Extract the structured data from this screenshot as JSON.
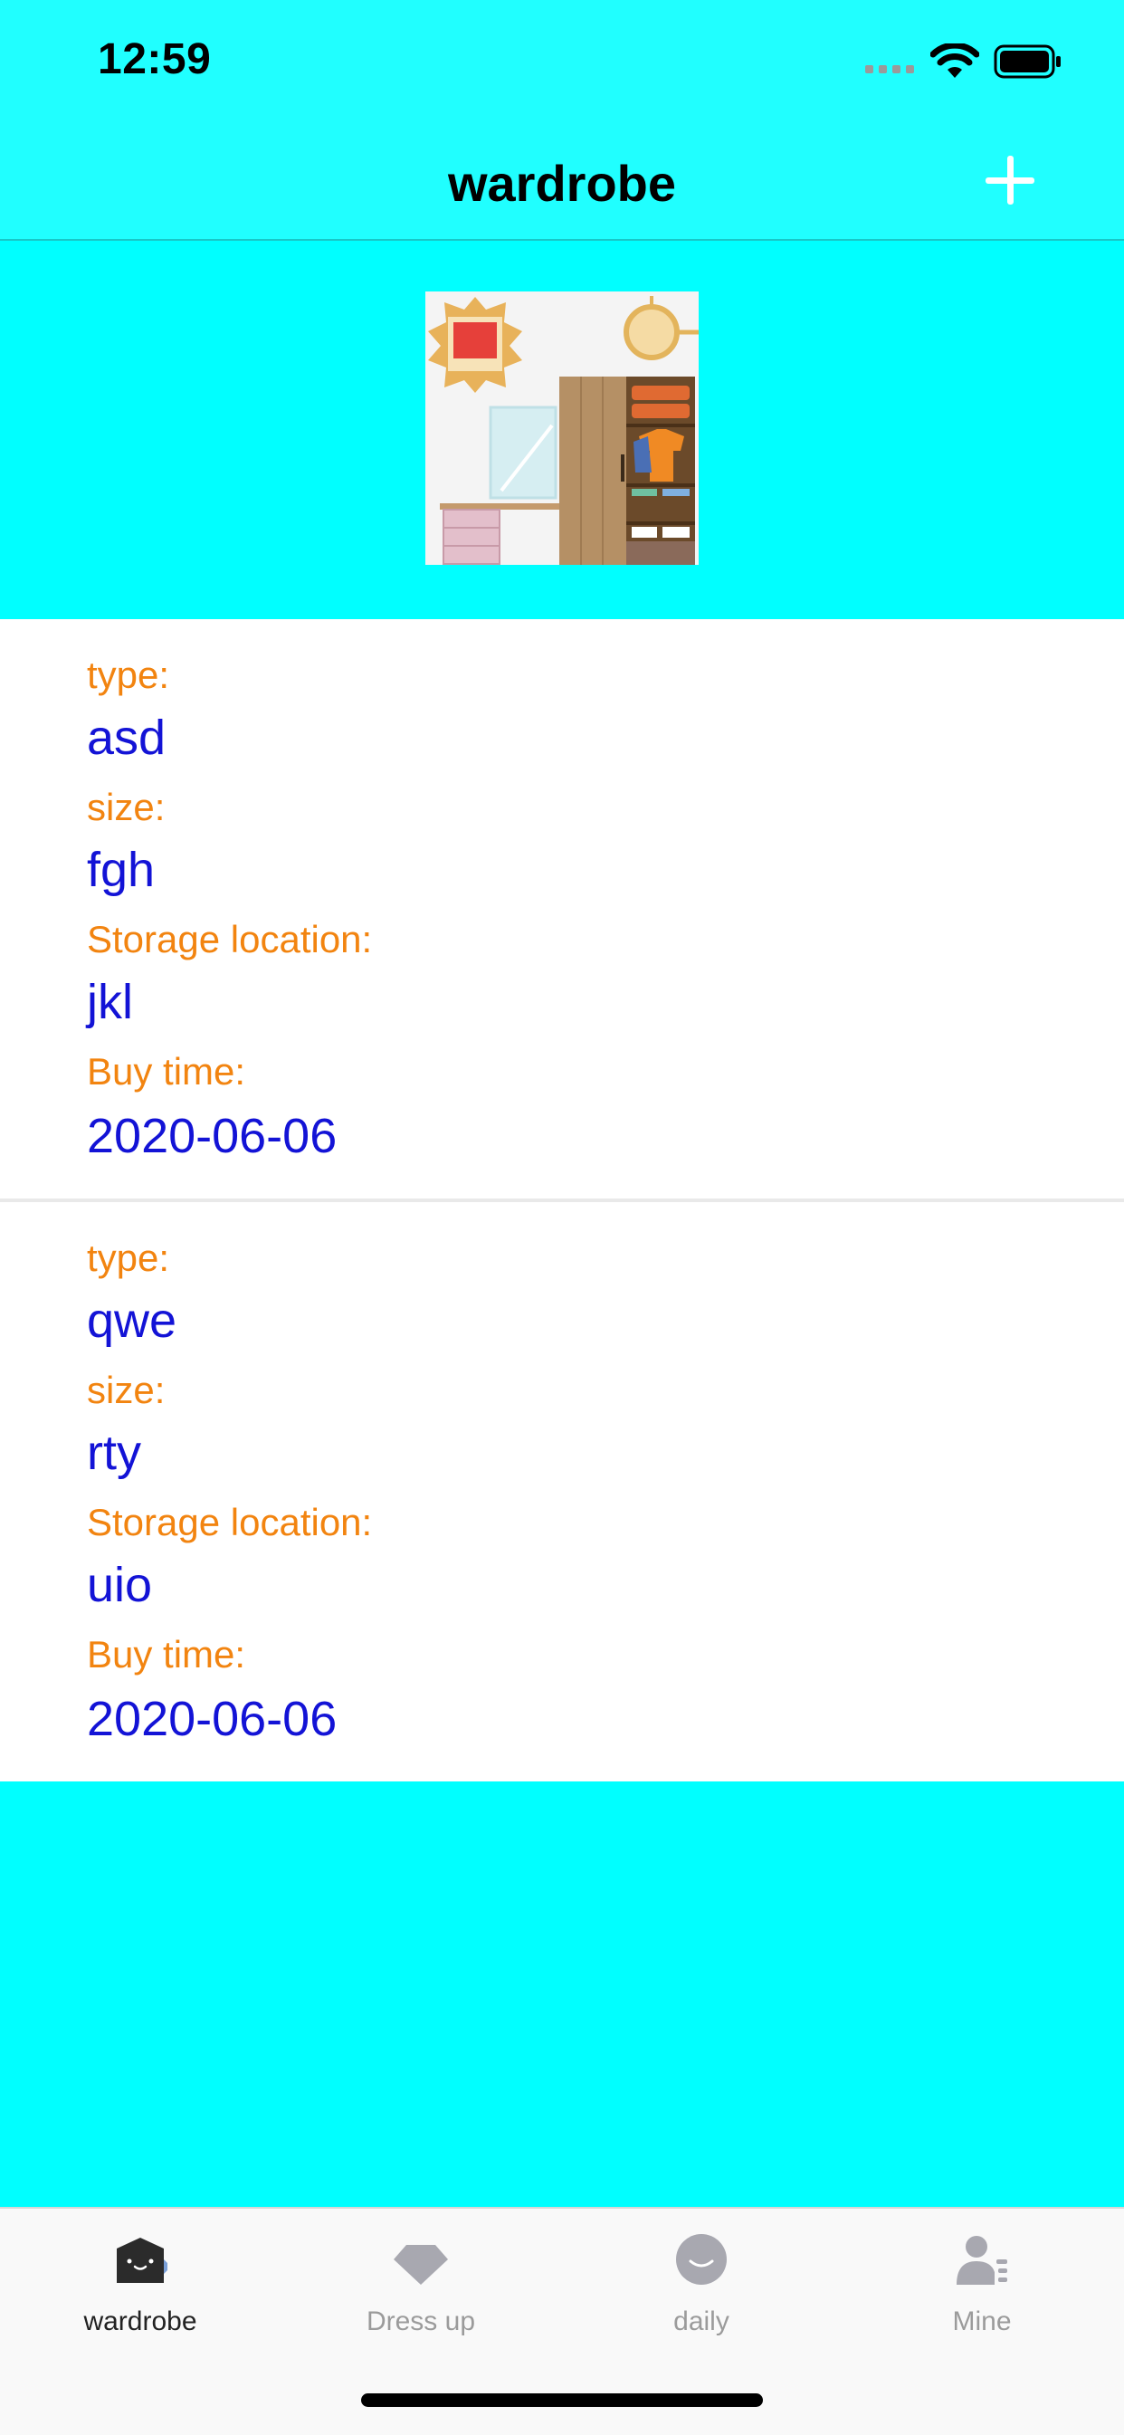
{
  "status_bar": {
    "time": "12:59"
  },
  "nav": {
    "title": "wardrobe",
    "add_icon": "plus-icon"
  },
  "colors": {
    "background": "#00FFFF",
    "label": "#F28410",
    "value": "#1313D6"
  },
  "items": [
    {
      "type_label": "type:",
      "type": "asd",
      "size_label": "size:",
      "size": "fgh",
      "location_label": "Storage location:",
      "location": "jkl",
      "buy_time_label": "Buy time:",
      "buy_time": "2020-06-06"
    },
    {
      "type_label": "type:",
      "type": "qwe",
      "size_label": "size:",
      "size": "rty",
      "location_label": "Storage location:",
      "location": "uio",
      "buy_time_label": "Buy time:",
      "buy_time": "2020-06-06"
    }
  ],
  "tabs": [
    {
      "label": "wardrobe",
      "icon": "wardrobe-icon",
      "active": true
    },
    {
      "label": "Dress up",
      "icon": "diamond-icon",
      "active": false
    },
    {
      "label": "daily",
      "icon": "smile-icon",
      "active": false
    },
    {
      "label": "Mine",
      "icon": "user-icon",
      "active": false
    }
  ]
}
